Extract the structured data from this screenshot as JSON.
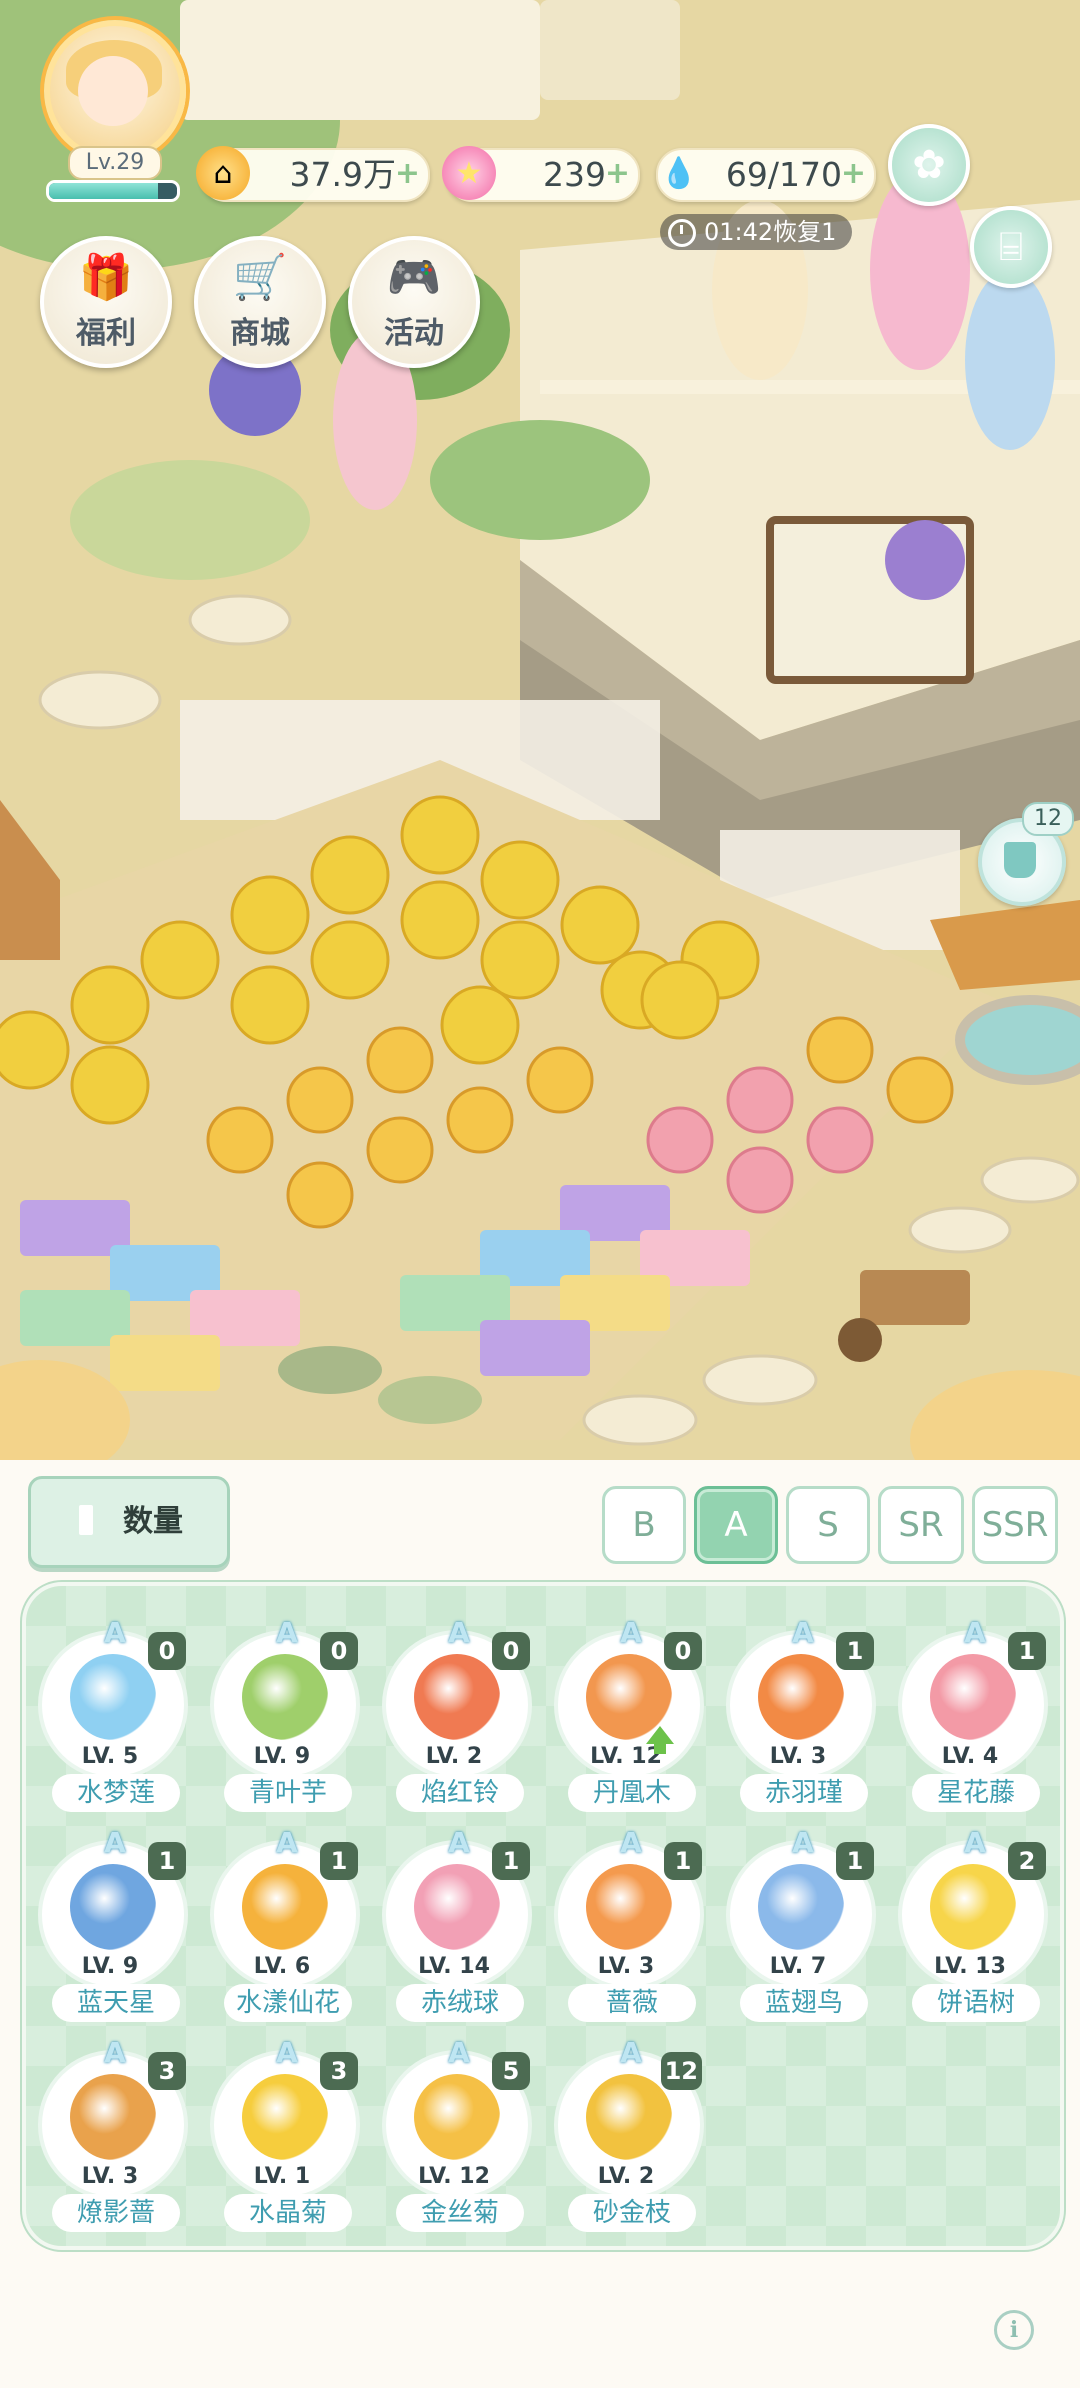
{
  "hud": {
    "level": "Lv.29",
    "xp_fraction": 0.85,
    "coins": "37.9万",
    "stars": "239",
    "water": "69/170",
    "plus": "+",
    "regen": "01:42恢复1",
    "icons": {
      "coin": "coin-icon",
      "star": "star-icon",
      "water": "water-drop-icon",
      "flower_menu": "flower-icon",
      "stairs": "stairs-icon"
    }
  },
  "menu": [
    {
      "label": "福利",
      "icon": "gift-icon"
    },
    {
      "label": "商城",
      "icon": "shopping-cart-icon"
    },
    {
      "label": "活动",
      "icon": "gamepad-icon"
    }
  ],
  "scene": {
    "water_tool_count": "12"
  },
  "panel": {
    "quantity_button": "数量",
    "rarity_tabs": [
      "B",
      "A",
      "S",
      "SR",
      "SSR"
    ],
    "selected_tab": "A",
    "items": [
      {
        "grade": "A",
        "count": "0",
        "level": "LV. 5",
        "name": "水梦莲",
        "color": "#8fd0f2"
      },
      {
        "grade": "A",
        "count": "0",
        "level": "LV. 9",
        "name": "青叶芋",
        "color": "#9fcf6b"
      },
      {
        "grade": "A",
        "count": "0",
        "level": "LV. 2",
        "name": "焰红铃",
        "color": "#f07a52"
      },
      {
        "grade": "A",
        "count": "0",
        "level": "LV. 12",
        "name": "丹凰木",
        "color": "#f2974f",
        "upgrade": true
      },
      {
        "grade": "A",
        "count": "1",
        "level": "LV. 3",
        "name": "赤羽瑾",
        "color": "#f28a45"
      },
      {
        "grade": "A",
        "count": "1",
        "level": "LV. 4",
        "name": "星花藤",
        "color": "#f39aa6"
      },
      {
        "grade": "A",
        "count": "1",
        "level": "LV. 9",
        "name": "蓝天星",
        "color": "#6fa6e0"
      },
      {
        "grade": "A",
        "count": "1",
        "level": "LV. 6",
        "name": "水漾仙花",
        "color": "#f5b23c"
      },
      {
        "grade": "A",
        "count": "1",
        "level": "LV. 14",
        "name": "赤绒球",
        "color": "#f2a0b5"
      },
      {
        "grade": "A",
        "count": "1",
        "level": "LV. 3",
        "name": "蔷薇",
        "color": "#f49a4e"
      },
      {
        "grade": "A",
        "count": "1",
        "level": "LV. 7",
        "name": "蓝翅鸟",
        "color": "#8bb9ea"
      },
      {
        "grade": "A",
        "count": "2",
        "level": "LV. 13",
        "name": "饼语树",
        "color": "#f7d54a"
      },
      {
        "grade": "A",
        "count": "3",
        "level": "LV. 3",
        "name": "燎影蔷",
        "color": "#e9a24c"
      },
      {
        "grade": "A",
        "count": "3",
        "level": "LV. 1",
        "name": "水晶菊",
        "color": "#f6cd3d"
      },
      {
        "grade": "A",
        "count": "5",
        "level": "LV. 12",
        "name": "金丝菊",
        "color": "#f5c046"
      },
      {
        "grade": "A",
        "count": "12",
        "level": "LV. 2",
        "name": "砂金枝",
        "color": "#f2c23f"
      }
    ],
    "info_glyph": "i"
  }
}
